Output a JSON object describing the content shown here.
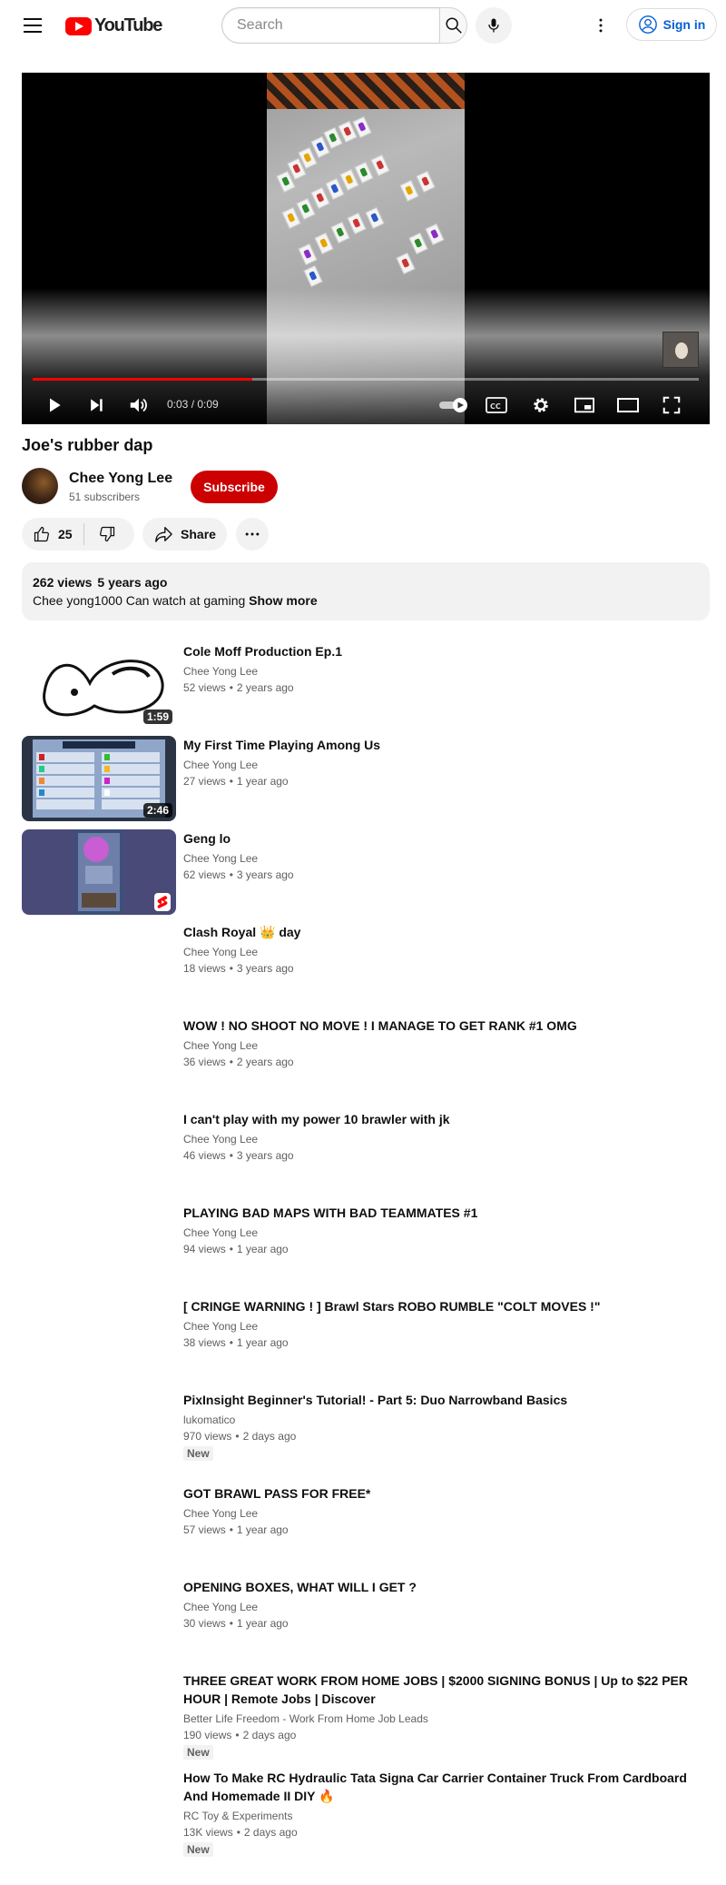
{
  "header": {
    "logo_text": "YouTube",
    "search_placeholder": "Search",
    "signin_label": "Sign in"
  },
  "player": {
    "time_display": "0:03 / 0:09",
    "progress_fraction": 0.33
  },
  "video": {
    "title": "Joe's rubber dap",
    "channel_name": "Chee Yong Lee",
    "subscribers": "51 subscribers",
    "subscribe_label": "Subscribe",
    "likes": "25",
    "share_label": "Share",
    "views": "262 views",
    "published": "5 years ago",
    "description": "Chee yong1000 Can watch at gaming ",
    "show_more": "Show more"
  },
  "recommendations": [
    {
      "title": "Cole Moff Production Ep.1",
      "channel": "Chee Yong Lee",
      "views": "52 views",
      "age": "2 years ago",
      "duration": "1:59",
      "thumb": "drawing"
    },
    {
      "title": "My First Time Playing Among Us",
      "channel": "Chee Yong Lee",
      "views": "27 views",
      "age": "1 year ago",
      "duration": "2:46",
      "thumb": "amongus"
    },
    {
      "title": "Geng lo",
      "channel": "Chee Yong Lee",
      "views": "62 views",
      "age": "3 years ago",
      "thumb": "short"
    },
    {
      "title": "Clash Royal 👑 day",
      "channel": "Chee Yong Lee",
      "views": "18 views",
      "age": "3 years ago"
    },
    {
      "title": "WOW ! NO SHOOT NO MOVE ! I MANAGE TO GET RANK #1 OMG",
      "channel": "Chee Yong Lee",
      "views": "36 views",
      "age": "2 years ago"
    },
    {
      "title": "I can't play with my power 10 brawler with jk",
      "channel": "Chee Yong Lee",
      "views": "46 views",
      "age": "3 years ago"
    },
    {
      "title": "PLAYING BAD MAPS WITH BAD TEAMMATES #1",
      "channel": "Chee Yong Lee",
      "views": "94 views",
      "age": "1 year ago"
    },
    {
      "title": "[ CRINGE WARNING ! ] Brawl Stars ROBO RUMBLE \"COLT MOVES !\"",
      "channel": "Chee Yong Lee",
      "views": "38 views",
      "age": "1 year ago"
    },
    {
      "title": "PixInsight Beginner's Tutorial! - Part 5: Duo Narrowband Basics",
      "channel": "lukomatico",
      "views": "970 views",
      "age": "2 days ago",
      "badge": "New"
    },
    {
      "title": "GOT BRAWL PASS FOR FREE*",
      "channel": "Chee Yong Lee",
      "views": "57 views",
      "age": "1 year ago"
    },
    {
      "title": "OPENING BOXES, WHAT WILL I GET ?",
      "channel": "Chee Yong Lee",
      "views": "30 views",
      "age": "1 year ago"
    },
    {
      "title": "THREE GREAT WORK FROM HOME JOBS | $2000 SIGNING BONUS | Up to $22 PER HOUR | Remote Jobs | Discover",
      "channel": "Better Life Freedom - Work From Home Job Leads",
      "views": "190 views",
      "age": "2 days ago",
      "badge": "New"
    },
    {
      "title": "How To Make RC Hydraulic Tata Signa Car Carrier Container Truck From Cardboard And Homemade II DIY 🔥",
      "channel": "RC Toy & Experiments",
      "views": "13K views",
      "age": "2 days ago",
      "badge": "New"
    }
  ],
  "colors": {
    "brand_red": "#ff0000",
    "subscribe_red": "#cc0000",
    "link_blue": "#065fd4"
  }
}
